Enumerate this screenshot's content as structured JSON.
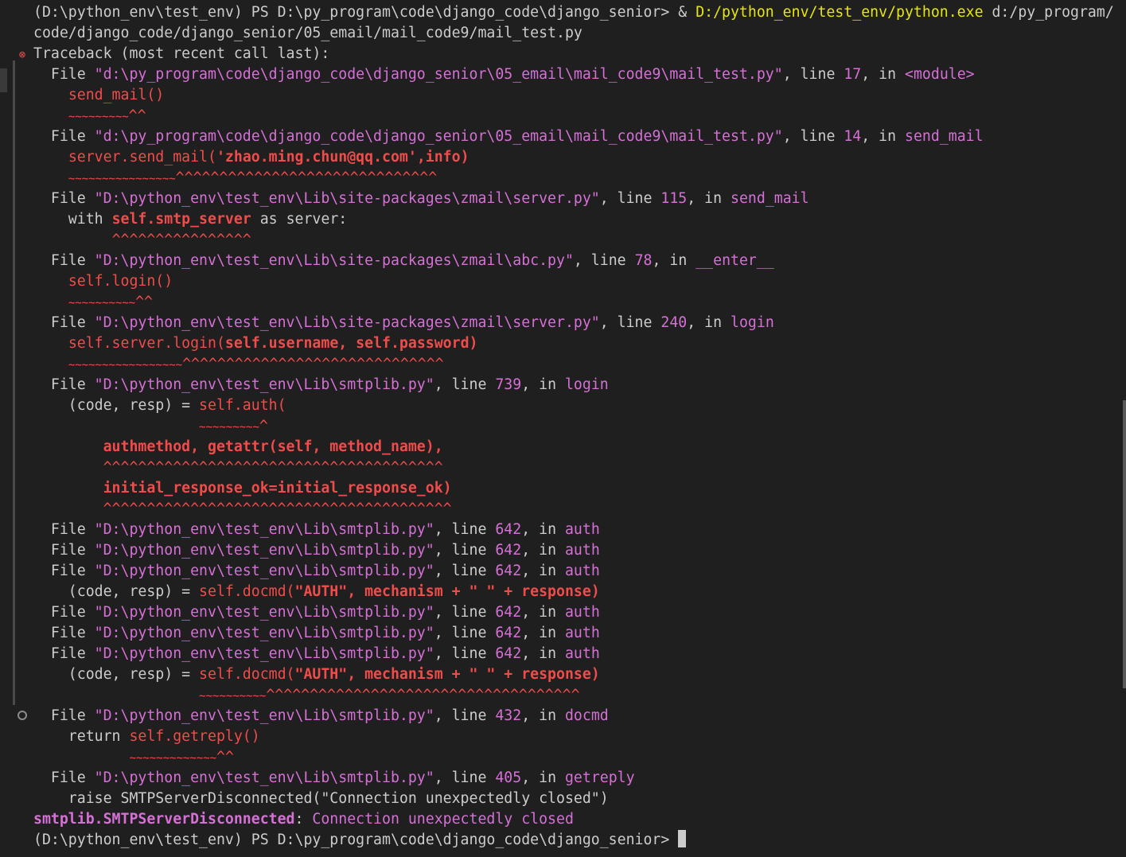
{
  "terminal": {
    "lines": [
      {
        "segments": [
          {
            "t": "(D:\\python_env\\test_env) PS D:\\py_program\\code\\django_code\\django_senior> & ",
            "s": "plain"
          },
          {
            "t": "D:/python_env/test_env/python.exe",
            "s": "cmd"
          },
          {
            "t": " d:/py_program/",
            "s": "plain"
          }
        ]
      },
      {
        "segments": [
          {
            "t": "code/django_code/django_senior/05_email/mail_code9/mail_test.py",
            "s": "plain"
          }
        ]
      },
      {
        "segments": [
          {
            "t": "Traceback (most recent call last):",
            "s": "plain"
          }
        ]
      },
      {
        "segments": [
          {
            "t": "  File ",
            "s": "plain"
          },
          {
            "t": "\"d:\\py_program\\code\\django_code\\django_senior\\05_email\\mail_code9\\mail_test.py\"",
            "s": "path"
          },
          {
            "t": ", line ",
            "s": "plain"
          },
          {
            "t": "17",
            "s": "num"
          },
          {
            "t": ", in ",
            "s": "plain"
          },
          {
            "t": "<module>",
            "s": "fn"
          }
        ]
      },
      {
        "segments": [
          {
            "t": "    ",
            "s": "plain"
          },
          {
            "t": "send_mail()",
            "s": "err"
          }
        ]
      },
      {
        "segments": [
          {
            "t": "    ",
            "s": "plain"
          },
          {
            "t": "~~~~~~~~~",
            "s": "wave"
          },
          {
            "t": "^^",
            "s": "caret"
          }
        ]
      },
      {
        "segments": [
          {
            "t": "  File ",
            "s": "plain"
          },
          {
            "t": "\"d:\\py_program\\code\\django_code\\django_senior\\05_email\\mail_code9\\mail_test.py\"",
            "s": "path"
          },
          {
            "t": ", line ",
            "s": "plain"
          },
          {
            "t": "14",
            "s": "num"
          },
          {
            "t": ", in ",
            "s": "plain"
          },
          {
            "t": "send_mail",
            "s": "fn"
          }
        ]
      },
      {
        "segments": [
          {
            "t": "    ",
            "s": "plain"
          },
          {
            "t": "server.send_mail(",
            "s": "err"
          },
          {
            "t": "'zhao.ming.chun@qq.com',info)",
            "s": "errb"
          }
        ]
      },
      {
        "segments": [
          {
            "t": "    ",
            "s": "plain"
          },
          {
            "t": "~~~~~~~~~~~~~~~~",
            "s": "wave"
          },
          {
            "t": "^^^^^^^^^^^^^^^^^^^^^^^^^^^^^^",
            "s": "caret"
          }
        ]
      },
      {
        "segments": [
          {
            "t": "  File ",
            "s": "plain"
          },
          {
            "t": "\"D:\\python_env\\test_env\\Lib\\site-packages\\zmail\\server.py\"",
            "s": "path"
          },
          {
            "t": ", line ",
            "s": "plain"
          },
          {
            "t": "115",
            "s": "num"
          },
          {
            "t": ", in ",
            "s": "plain"
          },
          {
            "t": "send_mail",
            "s": "fn"
          }
        ]
      },
      {
        "segments": [
          {
            "t": "    with ",
            "s": "plain"
          },
          {
            "t": "self.smtp_server",
            "s": "errb"
          },
          {
            "t": " as server:",
            "s": "plain"
          }
        ]
      },
      {
        "segments": [
          {
            "t": "         ",
            "s": "plain"
          },
          {
            "t": "^^^^^^^^^^^^^^^^",
            "s": "caret"
          }
        ]
      },
      {
        "segments": [
          {
            "t": "  File ",
            "s": "plain"
          },
          {
            "t": "\"D:\\python_env\\test_env\\Lib\\site-packages\\zmail\\abc.py\"",
            "s": "path"
          },
          {
            "t": ", line ",
            "s": "plain"
          },
          {
            "t": "78",
            "s": "num"
          },
          {
            "t": ", in ",
            "s": "plain"
          },
          {
            "t": "__enter__",
            "s": "fn"
          }
        ]
      },
      {
        "segments": [
          {
            "t": "    ",
            "s": "plain"
          },
          {
            "t": "self.login()",
            "s": "err"
          }
        ]
      },
      {
        "segments": [
          {
            "t": "    ",
            "s": "plain"
          },
          {
            "t": "~~~~~~~~~~",
            "s": "wave"
          },
          {
            "t": "^^",
            "s": "caret"
          }
        ]
      },
      {
        "segments": [
          {
            "t": "  File ",
            "s": "plain"
          },
          {
            "t": "\"D:\\python_env\\test_env\\Lib\\site-packages\\zmail\\server.py\"",
            "s": "path"
          },
          {
            "t": ", line ",
            "s": "plain"
          },
          {
            "t": "240",
            "s": "num"
          },
          {
            "t": ", in ",
            "s": "plain"
          },
          {
            "t": "login",
            "s": "fn"
          }
        ]
      },
      {
        "segments": [
          {
            "t": "    ",
            "s": "plain"
          },
          {
            "t": "self.server.login(",
            "s": "err"
          },
          {
            "t": "self.username, self.password)",
            "s": "errb"
          }
        ]
      },
      {
        "segments": [
          {
            "t": "    ",
            "s": "plain"
          },
          {
            "t": "~~~~~~~~~~~~~~~~~",
            "s": "wave"
          },
          {
            "t": "^^^^^^^^^^^^^^^^^^^^^^^^^^^^^^",
            "s": "caret"
          }
        ]
      },
      {
        "segments": [
          {
            "t": "  File ",
            "s": "plain"
          },
          {
            "t": "\"D:\\python_env\\test_env\\Lib\\smtplib.py\"",
            "s": "path"
          },
          {
            "t": ", line ",
            "s": "plain"
          },
          {
            "t": "739",
            "s": "num"
          },
          {
            "t": ", in ",
            "s": "plain"
          },
          {
            "t": "login",
            "s": "fn"
          }
        ]
      },
      {
        "segments": [
          {
            "t": "    (code, resp) = ",
            "s": "plain"
          },
          {
            "t": "self.auth(",
            "s": "err"
          }
        ]
      },
      {
        "segments": [
          {
            "t": "                   ",
            "s": "plain"
          },
          {
            "t": "~~~~~~~~~",
            "s": "wave"
          },
          {
            "t": "^",
            "s": "caret"
          }
        ]
      },
      {
        "segments": [
          {
            "t": "        ",
            "s": "plain"
          },
          {
            "t": "authmethod, getattr(self, method_name),",
            "s": "errb"
          }
        ]
      },
      {
        "segments": [
          {
            "t": "        ",
            "s": "plain"
          },
          {
            "t": "^^^^^^^^^^^^^^^^^^^^^^^^^^^^^^^^^^^^^^^",
            "s": "caret"
          }
        ]
      },
      {
        "segments": [
          {
            "t": "        ",
            "s": "plain"
          },
          {
            "t": "initial_response_ok=initial_response_ok)",
            "s": "errb"
          }
        ]
      },
      {
        "segments": [
          {
            "t": "        ",
            "s": "plain"
          },
          {
            "t": "^^^^^^^^^^^^^^^^^^^^^^^^^^^^^^^^^^^^^^^^",
            "s": "caret"
          }
        ]
      },
      {
        "segments": [
          {
            "t": "  File ",
            "s": "plain"
          },
          {
            "t": "\"D:\\python_env\\test_env\\Lib\\smtplib.py\"",
            "s": "path"
          },
          {
            "t": ", line ",
            "s": "plain"
          },
          {
            "t": "642",
            "s": "num"
          },
          {
            "t": ", in ",
            "s": "plain"
          },
          {
            "t": "auth",
            "s": "fn"
          }
        ]
      },
      {
        "segments": [
          {
            "t": "  File ",
            "s": "plain"
          },
          {
            "t": "\"D:\\python_env\\test_env\\Lib\\smtplib.py\"",
            "s": "path"
          },
          {
            "t": ", line ",
            "s": "plain"
          },
          {
            "t": "642",
            "s": "num"
          },
          {
            "t": ", in ",
            "s": "plain"
          },
          {
            "t": "auth",
            "s": "fn"
          }
        ]
      },
      {
        "segments": [
          {
            "t": "  File ",
            "s": "plain"
          },
          {
            "t": "\"D:\\python_env\\test_env\\Lib\\smtplib.py\"",
            "s": "path"
          },
          {
            "t": ", line ",
            "s": "plain"
          },
          {
            "t": "642",
            "s": "num"
          },
          {
            "t": ", in ",
            "s": "plain"
          },
          {
            "t": "auth",
            "s": "fn"
          }
        ]
      },
      {
        "segments": [
          {
            "t": "    (code, resp) = ",
            "s": "plain"
          },
          {
            "t": "self.docmd(",
            "s": "err"
          },
          {
            "t": "\"AUTH\", mechanism + \" \" + response)",
            "s": "errb"
          }
        ]
      },
      {
        "segments": [
          {
            "t": "  File ",
            "s": "plain"
          },
          {
            "t": "\"D:\\python_env\\test_env\\Lib\\smtplib.py\"",
            "s": "path"
          },
          {
            "t": ", line ",
            "s": "plain"
          },
          {
            "t": "642",
            "s": "num"
          },
          {
            "t": ", in ",
            "s": "plain"
          },
          {
            "t": "auth",
            "s": "fn"
          }
        ]
      },
      {
        "segments": [
          {
            "t": "  File ",
            "s": "plain"
          },
          {
            "t": "\"D:\\python_env\\test_env\\Lib\\smtplib.py\"",
            "s": "path"
          },
          {
            "t": ", line ",
            "s": "plain"
          },
          {
            "t": "642",
            "s": "num"
          },
          {
            "t": ", in ",
            "s": "plain"
          },
          {
            "t": "auth",
            "s": "fn"
          }
        ]
      },
      {
        "segments": [
          {
            "t": "  File ",
            "s": "plain"
          },
          {
            "t": "\"D:\\python_env\\test_env\\Lib\\smtplib.py\"",
            "s": "path"
          },
          {
            "t": ", line ",
            "s": "plain"
          },
          {
            "t": "642",
            "s": "num"
          },
          {
            "t": ", in ",
            "s": "plain"
          },
          {
            "t": "auth",
            "s": "fn"
          }
        ]
      },
      {
        "segments": [
          {
            "t": "    (code, resp) = ",
            "s": "plain"
          },
          {
            "t": "self.docmd(",
            "s": "err"
          },
          {
            "t": "\"AUTH\", mechanism + \" \" + response)",
            "s": "errb"
          }
        ]
      },
      {
        "segments": [
          {
            "t": "                   ",
            "s": "plain"
          },
          {
            "t": "~~~~~~~~~~",
            "s": "wave"
          },
          {
            "t": "^^^^^^^^^^^^^^^^^^^^^^^^^^^^^^^^^^^^",
            "s": "caret"
          }
        ]
      },
      {
        "segments": [
          {
            "t": "  File ",
            "s": "plain"
          },
          {
            "t": "\"D:\\python_env\\test_env\\Lib\\smtplib.py\"",
            "s": "path"
          },
          {
            "t": ", line ",
            "s": "plain"
          },
          {
            "t": "432",
            "s": "num"
          },
          {
            "t": ", in ",
            "s": "plain"
          },
          {
            "t": "docmd",
            "s": "fn"
          }
        ]
      },
      {
        "segments": [
          {
            "t": "    return ",
            "s": "plain"
          },
          {
            "t": "self.getreply()",
            "s": "err"
          }
        ]
      },
      {
        "segments": [
          {
            "t": "           ",
            "s": "plain"
          },
          {
            "t": "~~~~~~~~~~~~~",
            "s": "wave"
          },
          {
            "t": "^^",
            "s": "caret"
          }
        ]
      },
      {
        "segments": [
          {
            "t": "  File ",
            "s": "plain"
          },
          {
            "t": "\"D:\\python_env\\test_env\\Lib\\smtplib.py\"",
            "s": "path"
          },
          {
            "t": ", line ",
            "s": "plain"
          },
          {
            "t": "405",
            "s": "num"
          },
          {
            "t": ", in ",
            "s": "plain"
          },
          {
            "t": "getreply",
            "s": "fn"
          }
        ]
      },
      {
        "segments": [
          {
            "t": "    raise SMTPServerDisconnected(\"Connection unexpectedly closed\")",
            "s": "plain"
          }
        ]
      },
      {
        "segments": [
          {
            "t": "smtplib.SMTPServerDisconnected",
            "s": "exc"
          },
          {
            "t": ": ",
            "s": "plain"
          },
          {
            "t": "Connection unexpectedly closed",
            "s": "msg"
          }
        ]
      },
      {
        "segments": [
          {
            "t": "(D:\\python_env\\test_env) PS D:\\py_program\\code\\django_code\\django_senior> ",
            "s": "plain"
          }
        ],
        "cursor": true
      }
    ],
    "markers": {
      "error_glyph": "⊗",
      "error_icon": "error-circle-icon",
      "circle_icon": "decoration-circle-icon"
    },
    "colors": {
      "background": "#1f1f1f",
      "foreground": "#cccccc",
      "magenta": "#d670d6",
      "red": "#f14c4c",
      "yellow": "#e5e510"
    }
  }
}
